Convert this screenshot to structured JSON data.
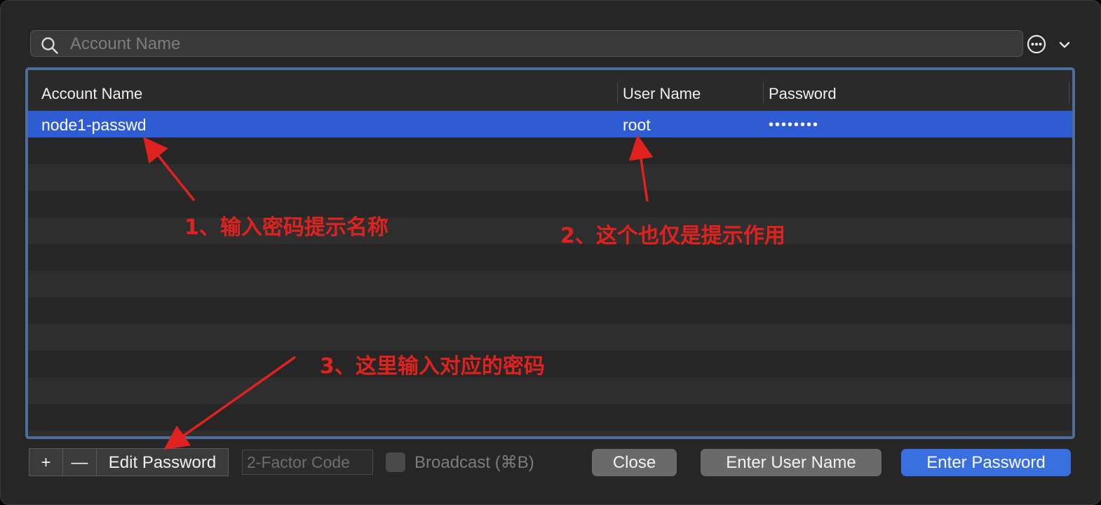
{
  "search": {
    "placeholder": "Account Name"
  },
  "table": {
    "columns": [
      "Account Name",
      "User Name",
      "Password"
    ],
    "rows": [
      {
        "account_name": "node1-passwd",
        "user_name": "root",
        "password": "••••••••",
        "selected": true
      }
    ]
  },
  "bottom_bar": {
    "add_label": "+",
    "remove_label": "—",
    "edit_password_label": "Edit Password",
    "two_factor_placeholder": "2-Factor Code",
    "broadcast_label": "Broadcast (⌘B)",
    "broadcast_checked": false,
    "close_label": "Close",
    "enter_user_name_label": "Enter User Name",
    "enter_password_label": "Enter Password"
  },
  "annotations": {
    "note1": "1、输入密码提示名称",
    "note2": "2、这个也仅是提示作用",
    "note3": "3、这里输入对应的密码"
  },
  "colors": {
    "window_bg": "#262626",
    "selection": "#2f5bd3",
    "table_border": "#4e6e9a",
    "primary_button": "#3a6fe0",
    "annotation": "#e0221e"
  },
  "icons": {
    "search": "search-icon",
    "more": "ellipsis-circle-icon",
    "dropdown": "chevron-down-icon"
  }
}
